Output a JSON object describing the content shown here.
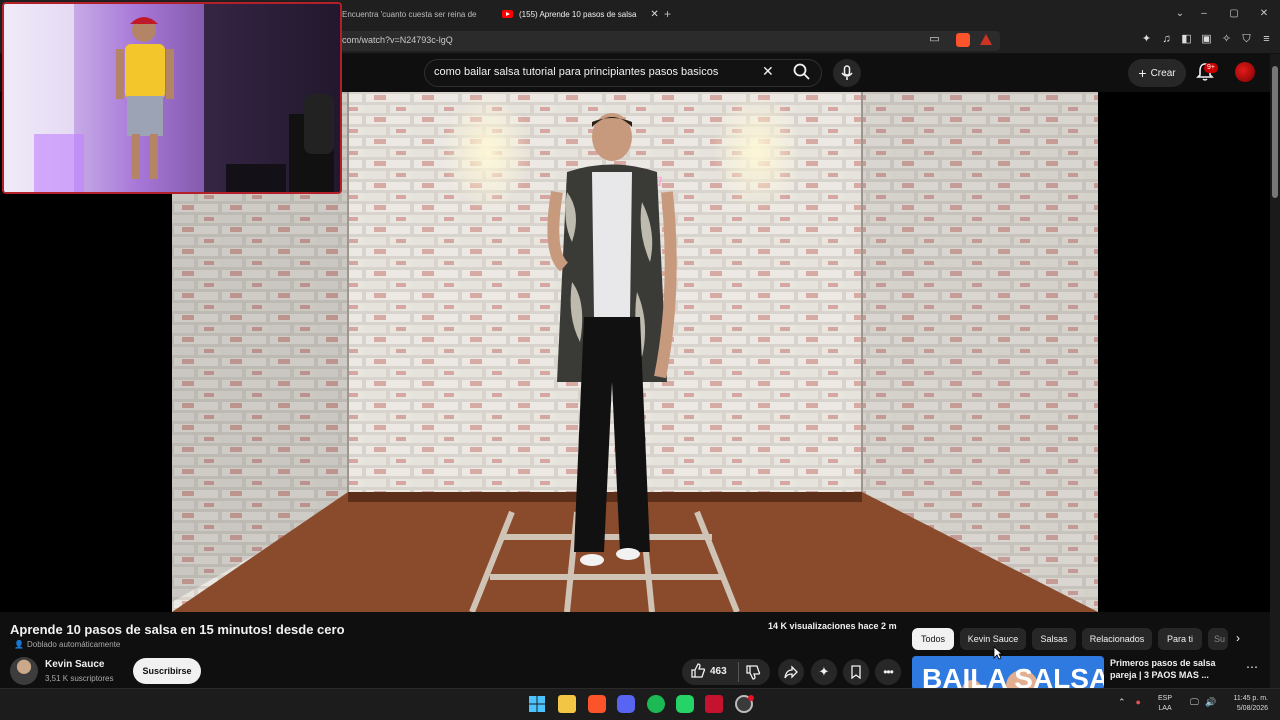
{
  "browser": {
    "tabs": [
      {
        "label": "Encuentra 'cuanto cuesta ser reina de",
        "active": false
      },
      {
        "label": "(155) Aprende 10 pasos de salsa",
        "active": true
      }
    ],
    "new_tab": "+",
    "url": "com/watch?v=N24793c-lgQ",
    "window_controls": {
      "min": "–",
      "max": "▢",
      "close": "✕",
      "dropdown": "⌄"
    }
  },
  "youtube": {
    "search_query": "como bailar salsa tutorial para principiantes pasos basicos",
    "create_label": "Crear",
    "notifications_badge": "9+",
    "video": {
      "title": "Aprende 10 pasos de salsa en 15 minutos! desde cero",
      "dubbed_label": "Doblado automáticamente",
      "views": "14 K visualizaciones  hace 2 m",
      "like_count": "463"
    },
    "channel": {
      "name": "Kevin Sauce",
      "subscribers": "3,51 K suscriptores",
      "subscribe_label": "Suscribirse"
    },
    "chips": [
      "Todos",
      "Kevin Sauce",
      "Salsas",
      "Relacionados",
      "Para ti",
      "Su"
    ],
    "recommendation": {
      "thumb_text": "BAILA SALSA",
      "title": "Primeros pasos de salsa pareja | 3 PAOS MAS ..."
    }
  },
  "taskbar": {
    "lang_line1": "ESP",
    "lang_line2": "LAA",
    "time": "11:45 p. m.",
    "date": "5/08/2026"
  },
  "colors": {
    "youtube_red": "#ff0000",
    "background": "#0f0f0f",
    "chip_bg": "#272727"
  }
}
